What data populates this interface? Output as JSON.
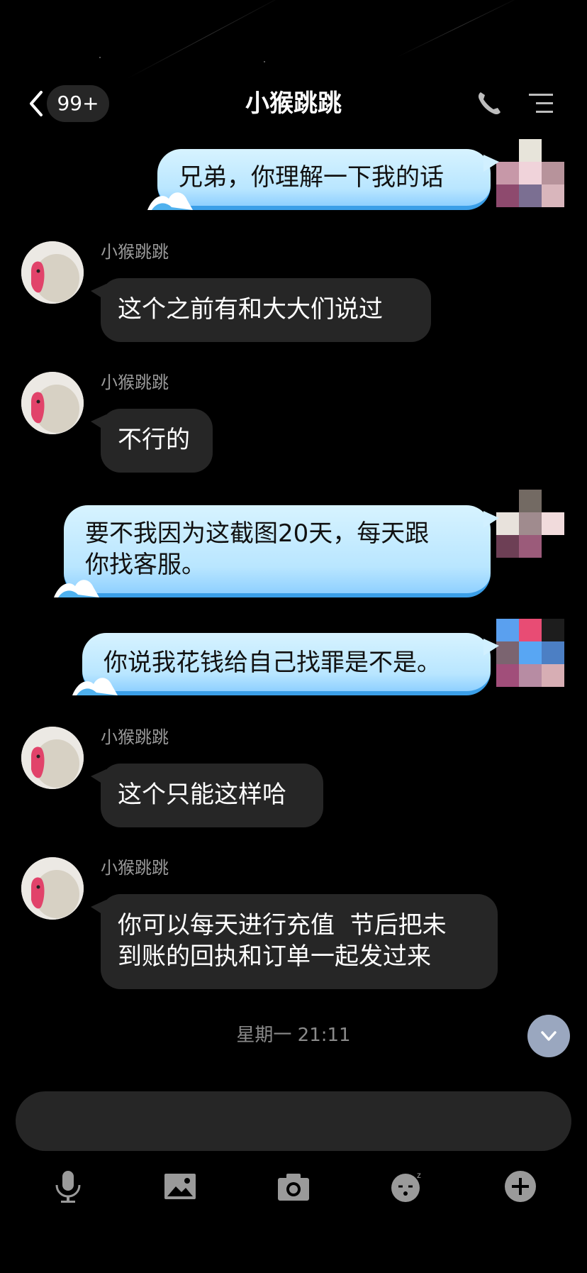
{
  "header": {
    "unread_badge": "99+",
    "title": "小猴跳跳"
  },
  "messages": [
    {
      "side": "out",
      "text_lines": [
        "兄弟，你理解一下我的话"
      ]
    },
    {
      "side": "in",
      "sender": "小猴跳跳",
      "text_lines": [
        "这个之前有和大大们说过"
      ]
    },
    {
      "side": "in",
      "sender": "小猴跳跳",
      "text_lines": [
        "不行的"
      ]
    },
    {
      "side": "out",
      "text_lines": [
        "要不我因为这截图20天，每天跟",
        "你找客服。"
      ]
    },
    {
      "side": "out",
      "text_lines": [
        "你说我花钱给自己找罪是不是。"
      ]
    },
    {
      "side": "in",
      "sender": "小猴跳跳",
      "text_lines": [
        "这个只能这样哈"
      ]
    },
    {
      "side": "in",
      "sender": "小猴跳跳",
      "text_lines": [
        "你可以每天进行充值  节后把未",
        "到账的回执和订单一起发过来"
      ]
    }
  ],
  "timestamp": "星期一 21:11",
  "icons": {
    "back": "chevron-left-icon",
    "phone": "phone-icon",
    "menu": "menu-icon",
    "scroll_down": "chevron-down-icon",
    "toolbar": [
      "microphone-icon",
      "image-icon",
      "camera-icon",
      "sticker-icon",
      "plus-icon"
    ]
  },
  "colors": {
    "background": "#000000",
    "incoming_bubble": "#262626",
    "outgoing_bubble": "#c7ecff",
    "sender_name": "#9a9a9a"
  }
}
